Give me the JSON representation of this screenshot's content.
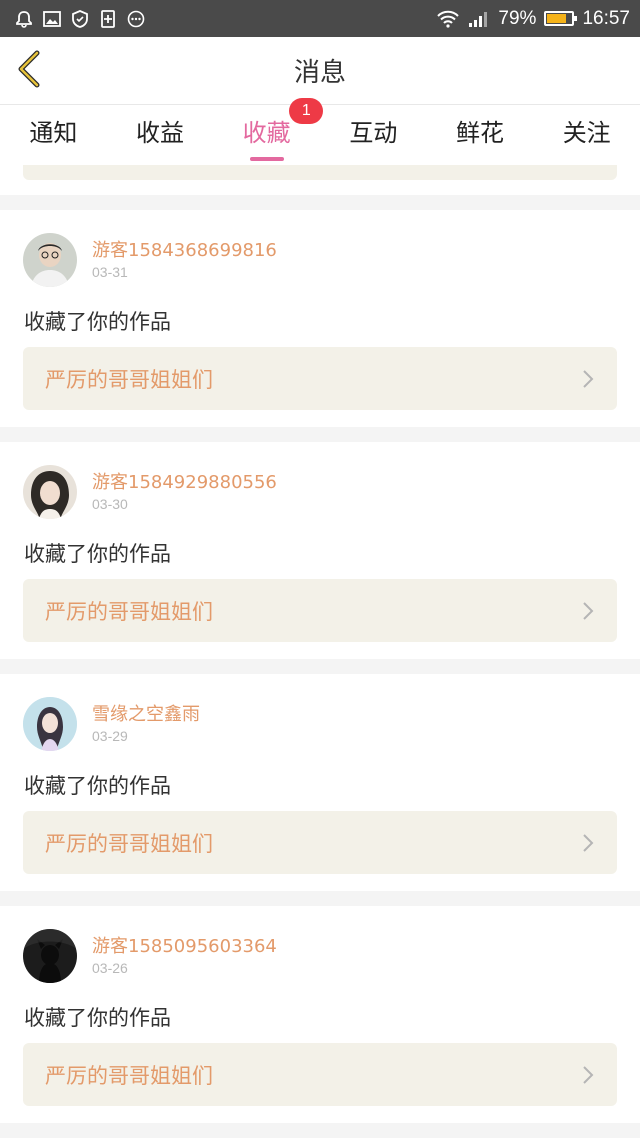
{
  "status_bar": {
    "battery": "79%",
    "battery_level": 0.79,
    "time": "16:57",
    "icons": [
      "notification-bell-icon",
      "image-icon",
      "shield-icon",
      "sim-icon",
      "more-dots-icon",
      "wifi-icon",
      "signal-icon",
      "battery-icon"
    ]
  },
  "header": {
    "title": "消息",
    "back_icon": "chevron-left-icon"
  },
  "tabs": [
    {
      "label": "通知"
    },
    {
      "label": "收益"
    },
    {
      "label": "收藏",
      "badge": "1",
      "active": true
    },
    {
      "label": "互动"
    },
    {
      "label": "鲜花"
    },
    {
      "label": "关注"
    }
  ],
  "items": [
    {
      "username": "游客1584368699816",
      "date": "03-31",
      "action": "收藏了你的作品",
      "work_title": "严厉的哥哥姐姐们"
    },
    {
      "username": "游客1584929880556",
      "date": "03-30",
      "action": "收藏了你的作品",
      "work_title": "严厉的哥哥姐姐们"
    },
    {
      "username": "雪缘之空鑫雨",
      "date": "03-29",
      "action": "收藏了你的作品",
      "work_title": "严厉的哥哥姐姐们"
    },
    {
      "username": "游客1585095603364",
      "date": "03-26",
      "action": "收藏了你的作品",
      "work_title": "严厉的哥哥姐姐们"
    }
  ],
  "colors": {
    "accent": "#e3699f",
    "username": "#e39a6a",
    "badge": "#ee3a46",
    "link_bg": "#f3f1e8"
  }
}
